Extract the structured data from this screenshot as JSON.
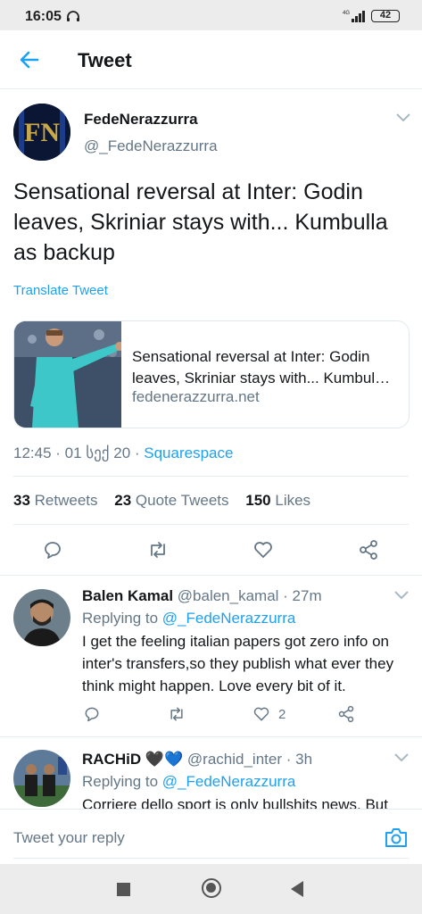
{
  "status_bar": {
    "time": "16:05",
    "network": "4G",
    "battery": "42"
  },
  "header": {
    "title": "Tweet",
    "back_icon": "back-arrow-icon"
  },
  "tweet": {
    "author_name": "FedeNerazzurra",
    "author_handle": "@_FedeNerazzurra",
    "avatar_text": "FN",
    "text": "Sensational reversal at Inter: Godin leaves, Skriniar stays with... Kumbulla as backup",
    "translate_label": "Translate Tweet",
    "card": {
      "title_line1": "Sensational reversal at Inter: Godin",
      "title_line2": "leaves, Skriniar stays with... Kumbul…",
      "domain": "fedenerazzurra.net"
    },
    "time": "12:45 · 01 სექ 20 · ",
    "source": "Squarespace",
    "stats": {
      "retweets_count": "33",
      "retweets_label": "Retweets",
      "quotes_count": "23",
      "quotes_label": "Quote Tweets",
      "likes_count": "150",
      "likes_label": "Likes"
    }
  },
  "replies": [
    {
      "name": "Balen Kamal",
      "handle": "@balen_kamal · 27m",
      "replying_prefix": "Replying to ",
      "replying_to": "@_FedeNerazzurra",
      "text": "I get the feeling italian papers got zero info on inter's transfers,so they publish what ever they think might happen. Love every bit of it.",
      "likes": "2"
    },
    {
      "name": "RACHiD",
      "emoji": "🖤💙",
      "handle": "@rachid_inter · 3h",
      "replying_prefix": "Replying to ",
      "replying_to": "@_FedeNerazzurra",
      "text": "Corriere dello sport is only bullshits news. But"
    }
  ],
  "composer": {
    "placeholder": "Tweet your reply"
  },
  "colors": {
    "accent": "#1da1f2",
    "secondary_text": "#657786",
    "divider": "#e6ecf0"
  }
}
